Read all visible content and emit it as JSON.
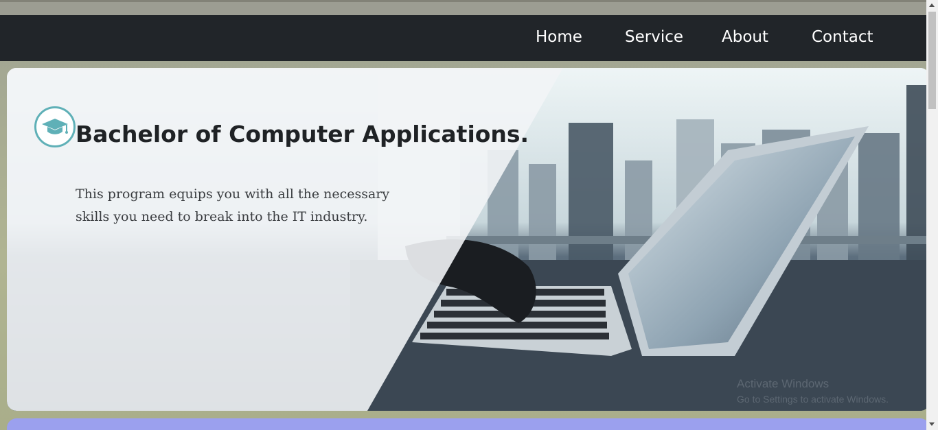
{
  "nav": {
    "items": [
      {
        "label": "Home"
      },
      {
        "label": "Service"
      },
      {
        "label": "About"
      },
      {
        "label": "Contact"
      }
    ]
  },
  "hero": {
    "icon": "graduation-cap-icon",
    "title": "Bachelor of Computer Applications.",
    "description": "This program equips you with all the necessary skills you need to break into the IT industry."
  },
  "watermark": {
    "line1": "Activate Windows",
    "line2": "Go to Settings to activate Windows."
  },
  "colors": {
    "navbar": "#212529",
    "accent_teal": "#5fb0b7",
    "next_section": "#9ba0ee"
  }
}
